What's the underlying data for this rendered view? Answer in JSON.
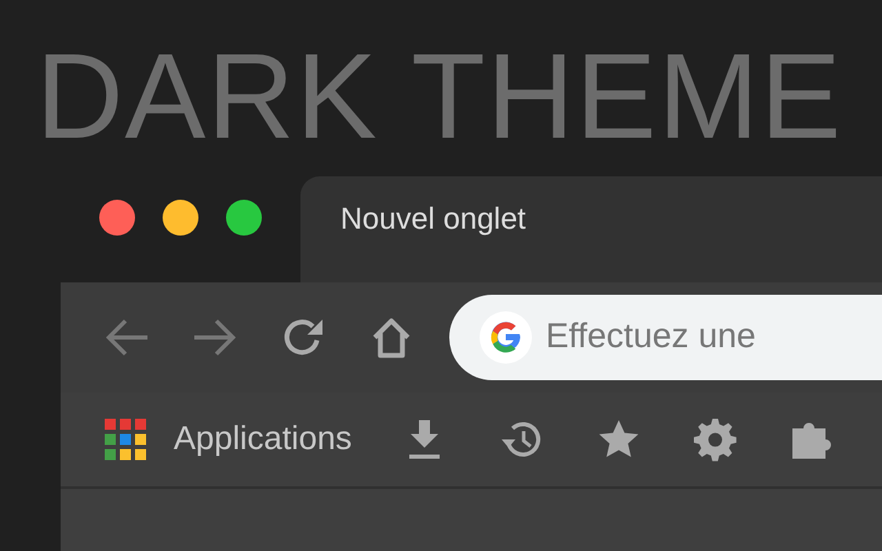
{
  "headline": "DARK THEME",
  "tabs": [
    {
      "label": "Nouvel onglet",
      "selected": true
    }
  ],
  "omnibox": {
    "placeholder": "Effectuez une"
  },
  "bookmarks": [
    {
      "label": "Applications"
    }
  ]
}
